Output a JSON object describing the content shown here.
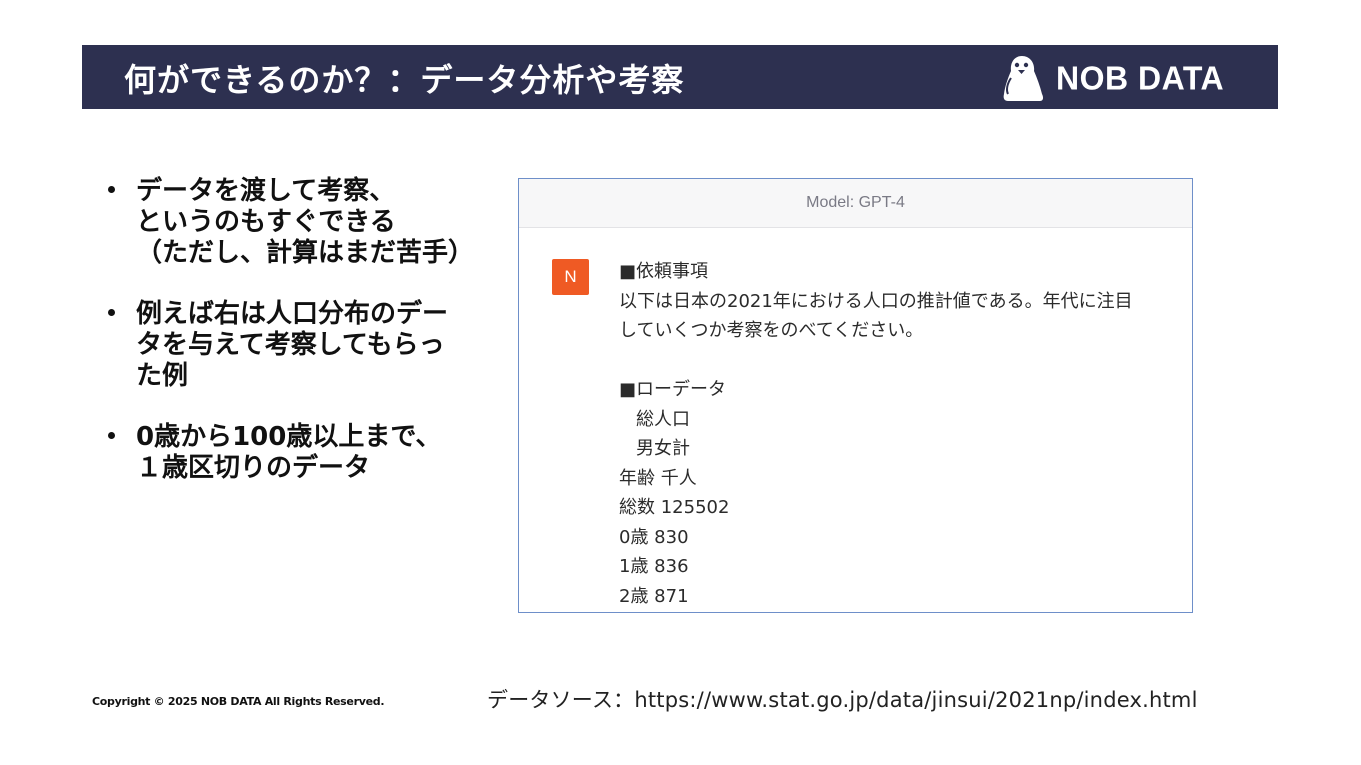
{
  "header": {
    "title": "何ができるのか？：データ分析や考察",
    "logo_text": "NOB DATA",
    "logo_icon": "penguin-logo-icon",
    "background_color": "#2d3050"
  },
  "bullets": [
    {
      "lines": [
        "データを渡して考察、",
        "というのもすぐできる",
        "（ただし、計算はまだ苦手）"
      ]
    },
    {
      "lines": [
        "例えば右は人口分布のデー",
        "タを与えて考察してもらっ",
        "た例"
      ]
    },
    {
      "lines": [
        "0歳から100歳以上まで、",
        "１歳区切りのデータ"
      ]
    }
  ],
  "chat": {
    "model_label": "Model: GPT-4",
    "avatar_letter": "N",
    "avatar_color": "#ef5a24",
    "lines": [
      "■依頼事項",
      "以下は日本の2021年における人口の推計値である。年代に注目",
      "していくつか考察をのべてください。",
      "",
      "■ローデータ",
      "総人口",
      "男女計",
      "年齢  千人",
      "総数  125502",
      "0歳   830",
      "1歳 836",
      "2歳   871"
    ]
  },
  "source": "データソース：https://www.stat.go.jp/data/jinsui/2021np/index.html",
  "copyright": "Copyright © 2025 NOB DATA All Rights Reserved."
}
